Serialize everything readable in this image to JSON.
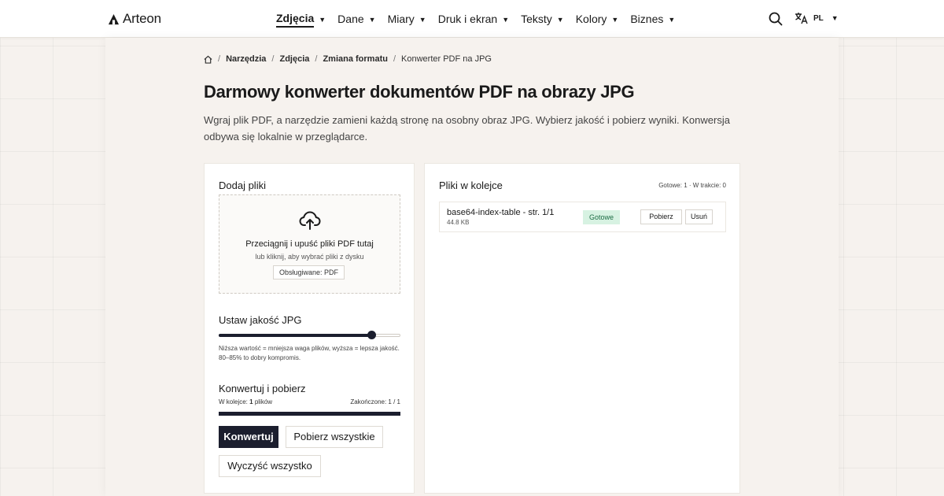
{
  "brand": {
    "name": "Arteon"
  },
  "nav": {
    "items": [
      {
        "label": "Zdjęcia",
        "active": true
      },
      {
        "label": "Dane"
      },
      {
        "label": "Miary"
      },
      {
        "label": "Druk i ekran"
      },
      {
        "label": "Teksty"
      },
      {
        "label": "Kolory"
      },
      {
        "label": "Biznes"
      }
    ],
    "caret": "▼",
    "language": "PL"
  },
  "breadcrumb": {
    "items": [
      "Narzędzia",
      "Zdjęcia",
      "Zmiana formatu"
    ],
    "current": "Konwerter PDF na JPG",
    "separator": "/"
  },
  "page": {
    "title": "Darmowy konwerter dokumentów PDF na obrazy JPG",
    "description": "Wgraj plik PDF, a narzędzie zamieni każdą stronę na osobny obraz JPG. Wybierz jakość i pobierz wyniki. Konwersja odbywa się lokalnie w przeglądarce."
  },
  "upload": {
    "title": "Dodaj pliki",
    "dropzone_title": "Przeciągnij i upuść pliki PDF tutaj",
    "dropzone_sub": "lub kliknij, aby wybrać pliki z dysku",
    "supported": "Obsługiwane: PDF"
  },
  "quality": {
    "title": "Ustaw jakość JPG",
    "value_fraction": 0.84,
    "hint": "Niższa wartość = mniejsza waga plików, wyższa = lepsza jakość. 80–85% to dobry kompromis."
  },
  "convert": {
    "title": "Konwertuj i pobierz",
    "queue_label": "W kolejce:",
    "queue_count": "1",
    "queue_unit": "plików",
    "completed": "Zakończone: 1 / 1",
    "progress_fraction": 1.0,
    "convert_button": "Konwertuj",
    "download_all_button": "Pobierz wszystkie",
    "clear_all_button": "Wyczyść wszystko"
  },
  "queue": {
    "title": "Pliki w kolejce",
    "stats": "Gotowe: 1 · W trakcie: 0",
    "files": [
      {
        "name": "base64-index-table - str. 1/1",
        "size": "44.8 KB",
        "status": "Gotowe",
        "download": "Pobierz",
        "remove": "Usuń"
      }
    ]
  },
  "colors": {
    "accent": "#1b1e2e",
    "success_bg": "#d7f2e2",
    "success_text": "#1d6d45"
  }
}
